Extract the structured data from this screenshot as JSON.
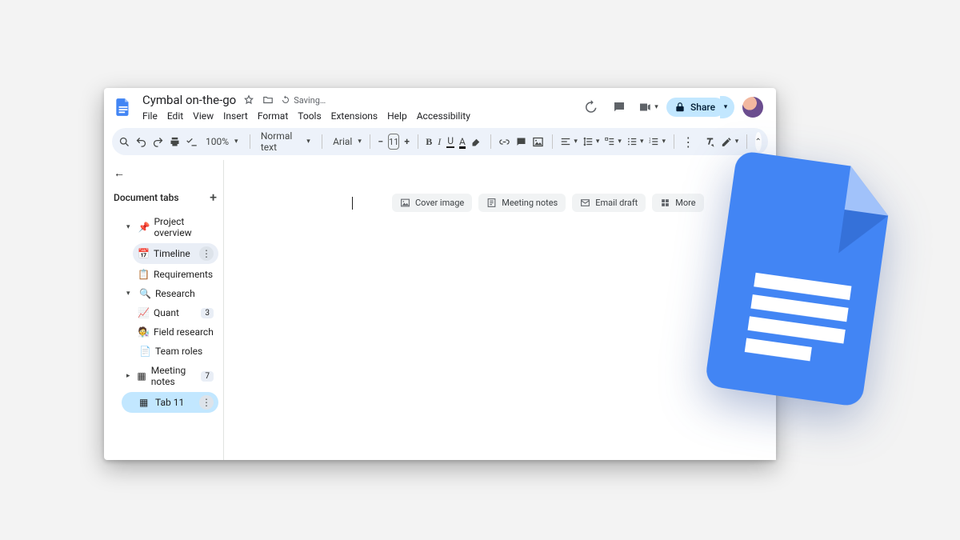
{
  "doc": {
    "title": "Cymbal on-the-go",
    "saving": "Saving…"
  },
  "menu": [
    "File",
    "Edit",
    "View",
    "Insert",
    "Format",
    "Tools",
    "Extensions",
    "Help",
    "Accessibility"
  ],
  "header": {
    "share": "Share"
  },
  "toolbar": {
    "zoom": "100%",
    "style": "Normal text",
    "font": "Arial",
    "font_size": "11"
  },
  "sidebar": {
    "heading": "Document tabs",
    "items": [
      {
        "label": "Project overview",
        "emoji": "📌",
        "caret": "▾",
        "indent": 1
      },
      {
        "label": "Timeline",
        "emoji": "📅",
        "indent": 2,
        "state": "hover",
        "menu": true
      },
      {
        "label": "Requirements",
        "emoji": "📋",
        "indent": 2
      },
      {
        "label": "Research",
        "emoji": "🔍",
        "caret": "▾",
        "indent": 1
      },
      {
        "label": "Quant",
        "emoji": "📈",
        "indent": 2,
        "badge": "3"
      },
      {
        "label": "Field research",
        "emoji": "🧑‍🔬",
        "indent": 2
      },
      {
        "label": "Team roles",
        "emoji": "📄",
        "indent": 1
      },
      {
        "label": "Meeting notes",
        "emoji": "▦",
        "caret": "▸",
        "indent": 1,
        "badge": "7"
      },
      {
        "label": "Tab 11",
        "emoji": "▦",
        "indent": 1,
        "state": "selected",
        "menu": true
      }
    ]
  },
  "chips": [
    {
      "icon": "image",
      "label": "Cover image"
    },
    {
      "icon": "notes",
      "label": "Meeting notes"
    },
    {
      "icon": "email",
      "label": "Email draft"
    },
    {
      "icon": "more",
      "label": "More"
    }
  ]
}
